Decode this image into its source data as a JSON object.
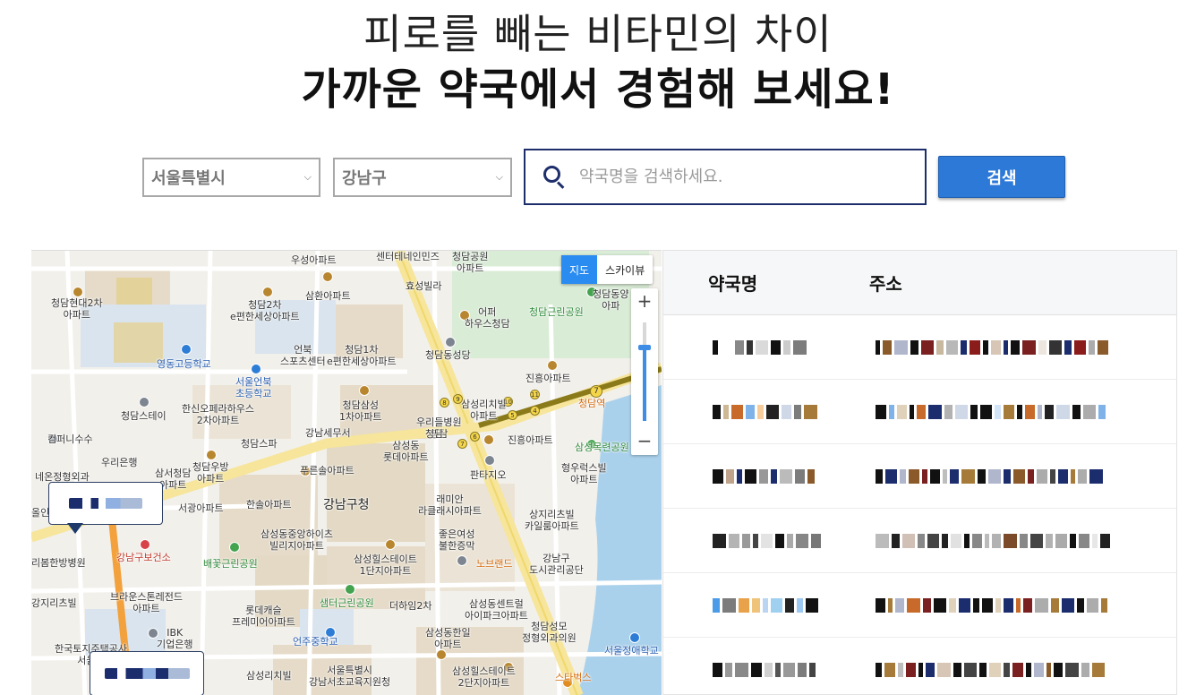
{
  "header": {
    "line1": "피로를 빼는 비타민의 차이",
    "line2": "가까운 약국에서 경험해 보세요!"
  },
  "search": {
    "city": "서울특별시",
    "district": "강남구",
    "placeholder": "약국명을 검색하세요.",
    "button_label": "검색"
  },
  "map": {
    "type_options": [
      "지도",
      "스카이뷰"
    ],
    "selected_type": "지도",
    "zoom_in_label": "+",
    "zoom_out_label": "−",
    "zoom_level_fraction": 0.75,
    "labels": [
      {
        "text": "청담현대2차\n아파트",
        "style": "normal"
      },
      {
        "text": "청담2차\ne편한세상아파트",
        "style": "normal"
      },
      {
        "text": "삼환아파트",
        "style": "normal"
      },
      {
        "text": "우성아파트",
        "style": "normal"
      },
      {
        "text": "효성빌라",
        "style": "normal"
      },
      {
        "text": "청담공원\n아파트",
        "style": "normal"
      },
      {
        "text": "청담동양\n아파",
        "style": "normal"
      },
      {
        "text": "청담근린공원",
        "style": "green"
      },
      {
        "text": "어퍼\n하우스청담",
        "style": "normal"
      },
      {
        "text": "영동고등학교",
        "style": "blue"
      },
      {
        "text": "서울언북\n초등학교",
        "style": "blue"
      },
      {
        "text": "언북\n스포츠센터",
        "style": "normal"
      },
      {
        "text": "청담1차\ne편한세상아파트",
        "style": "normal"
      },
      {
        "text": "청담동성당",
        "style": "normal"
      },
      {
        "text": "진흥아파트",
        "style": "normal"
      },
      {
        "text": "청담역",
        "style": "orange"
      },
      {
        "text": "청담스테이",
        "style": "normal"
      },
      {
        "text": "한신오페라하우스\n2차아파트",
        "style": "normal"
      },
      {
        "text": "청담삼성\n1차아파트",
        "style": "normal"
      },
      {
        "text": "우리들병원\n청담",
        "style": "normal"
      },
      {
        "text": "삼성리치빌\n아파트",
        "style": "normal"
      },
      {
        "text": "진흥아파트",
        "style": "normal"
      },
      {
        "text": "삼성목련공원",
        "style": "green"
      },
      {
        "text": "컴퍼니수수",
        "style": "normal"
      },
      {
        "text": "우리은행",
        "style": "normal"
      },
      {
        "text": "청담스파",
        "style": "normal"
      },
      {
        "text": "강남세무서",
        "style": "normal"
      },
      {
        "text": "삼성동\n롯데아파트",
        "style": "normal"
      },
      {
        "text": "판타지오",
        "style": "normal"
      },
      {
        "text": "형우럭스빌\n아파트",
        "style": "normal"
      },
      {
        "text": "네온정형외과",
        "style": "normal"
      },
      {
        "text": "삼서청담\n아파트",
        "style": "normal"
      },
      {
        "text": "청담우방\n아파트",
        "style": "normal"
      },
      {
        "text": "푸른솔아파트",
        "style": "normal"
      },
      {
        "text": "서광아파트",
        "style": "normal"
      },
      {
        "text": "한솔아파트",
        "style": "normal"
      },
      {
        "text": "강남구청",
        "style": "big"
      },
      {
        "text": "래미안\n라클래시아파트",
        "style": "normal"
      },
      {
        "text": "상지리츠빌\n카일룸아파트",
        "style": "normal"
      },
      {
        "text": "올인",
        "style": "normal"
      },
      {
        "text": "강남구보건소",
        "style": "red"
      },
      {
        "text": "삼성동중앙하이츠\n빌리지아파트",
        "style": "normal"
      },
      {
        "text": "좋은여성\n불한증막",
        "style": "normal"
      },
      {
        "text": "노브랜드",
        "style": "orange"
      },
      {
        "text": "강남구\n도시관리공단",
        "style": "normal"
      },
      {
        "text": "리봄한방병원",
        "style": "normal"
      },
      {
        "text": "배꽃근린공원",
        "style": "green"
      },
      {
        "text": "삼성힐스테이트\n1단지아파트",
        "style": "normal"
      },
      {
        "text": "강지리츠빌",
        "style": "normal"
      },
      {
        "text": "브라운스톤레전드\n아파트",
        "style": "normal"
      },
      {
        "text": "롯데캐슬\n프레미어아파트",
        "style": "normal"
      },
      {
        "text": "샘터근린공원",
        "style": "green"
      },
      {
        "text": "더하임2차",
        "style": "normal"
      },
      {
        "text": "삼성동센트럴\n아이파크아파트",
        "style": "normal"
      },
      {
        "text": "IBK\n기업은행",
        "style": "normal"
      },
      {
        "text": "청담성모\n정형외과의원",
        "style": "normal"
      },
      {
        "text": "한국토지주택공사\n서울지",
        "style": "normal"
      },
      {
        "text": "언주중학교",
        "style": "blue"
      },
      {
        "text": "삼성동한일\n아파트",
        "style": "normal"
      },
      {
        "text": "서울정애학교",
        "style": "blue"
      },
      {
        "text": "삼성리치빌",
        "style": "normal"
      },
      {
        "text": "서울특별시\n강남서초교육지원청",
        "style": "normal"
      },
      {
        "text": "삼성힐스테이트\n2단지아파트",
        "style": "normal"
      },
      {
        "text": "스타벅스",
        "style": "orange"
      },
      {
        "text": "센터테네인민즈",
        "style": "normal"
      },
      {
        "text": "청담",
        "style": "normal"
      }
    ]
  },
  "table": {
    "headers": {
      "name": "약국명",
      "address": "주소"
    },
    "rows": [
      {
        "name": "",
        "address": ""
      },
      {
        "name": "",
        "address": ""
      },
      {
        "name": "",
        "address": ""
      },
      {
        "name": "",
        "address": ""
      },
      {
        "name": "",
        "address": ""
      },
      {
        "name": "",
        "address": ""
      }
    ]
  },
  "colors": {
    "accent": "#2d79d8",
    "search_border": "#1d2e6b",
    "map_toggle_active": "#2a8cf0",
    "header_bg": "#f6f7f8"
  },
  "icons": [
    "search-icon",
    "chevron-down-icon",
    "map-marker-icon"
  ]
}
